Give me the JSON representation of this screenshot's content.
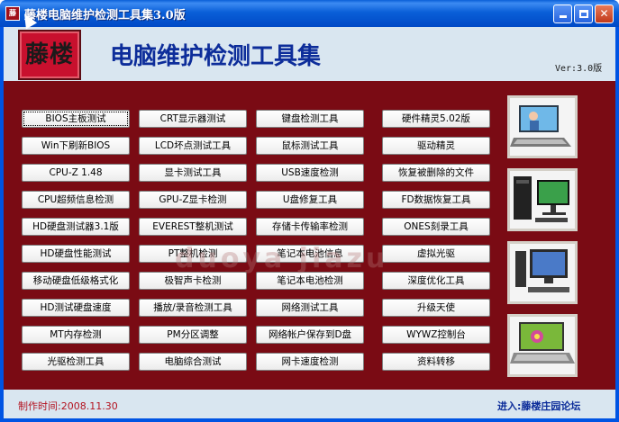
{
  "window": {
    "title": "藤楼电脑维护检测工具集3.0版",
    "logo_text": "藤楼",
    "main_title": "电脑维护检测工具集",
    "version": "Ver:3.0版"
  },
  "buttons": [
    [
      "BIOS主板测试",
      "CRT显示器测试",
      "键盘检测工具",
      "硬件精灵5.02版"
    ],
    [
      "Win下刷新BIOS",
      "LCD坏点测试工具",
      "鼠标测试工具",
      "驱动精灵"
    ],
    [
      "CPU-Z 1.48",
      "显卡测试工具",
      "USB速度检测",
      "恢复被删除的文件"
    ],
    [
      "CPU超频信息检测",
      "GPU-Z显卡检测",
      "U盘修复工具",
      "FD数据恢复工具"
    ],
    [
      "HD硬盘测试器3.1版",
      "EVEREST整机测试",
      "存储卡传输率检测",
      "ONES刻录工具"
    ],
    [
      "HD硬盘性能测试",
      "PT整机检测",
      "笔记本电池信息",
      "虚拟光驱"
    ],
    [
      "移动硬盘低级格式化",
      "极智声卡检测",
      "笔记本电池检测",
      "深度优化工具"
    ],
    [
      "HD测试硬盘速度",
      "播放/录音检测工具",
      "网络测试工具",
      "升级天使"
    ],
    [
      "MT内存检测",
      "PM分区调整",
      "网络帐户保存到D盘",
      "WYWZ控制台"
    ],
    [
      "光驱检测工具",
      "电脑综合测试",
      "网卡速度检测",
      "资料转移"
    ]
  ],
  "footer": {
    "made_time": "制作时间:2008.11.30",
    "enter_link": "进入:藤楼庄园论坛"
  },
  "watermark": "duoya jiazu",
  "colors": {
    "panel": "#7a0b14",
    "header": "#d9e6f0",
    "title_blue": "#0d2d9a",
    "footer_red": "#b3121f"
  },
  "images": [
    "laptop-with-woman",
    "desktop-pc-with-lcd",
    "desktop-pc-with-crt",
    "laptop-with-flower"
  ]
}
